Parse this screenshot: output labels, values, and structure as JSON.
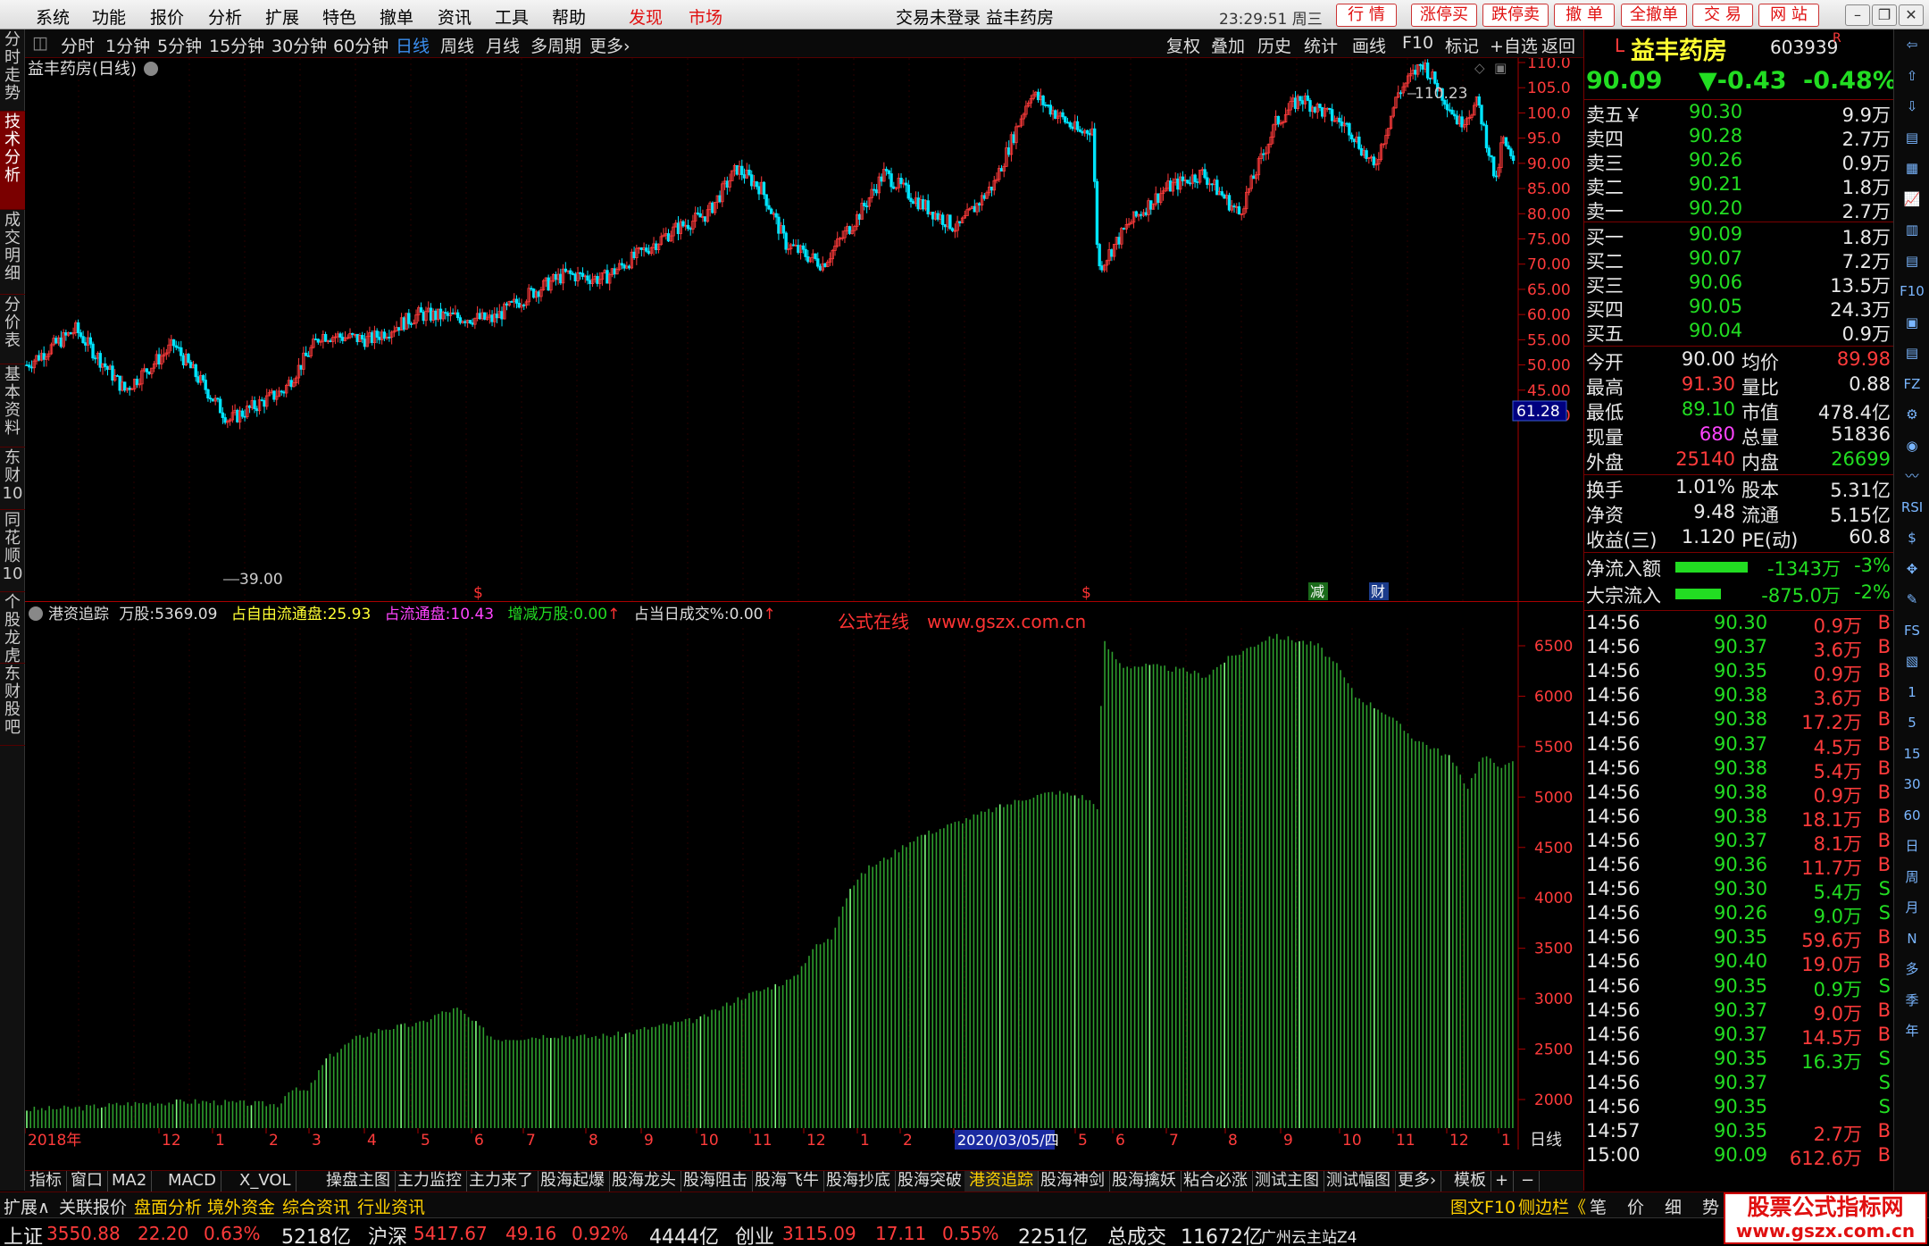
{
  "menubar": {
    "items": [
      "系统",
      "功能",
      "报价",
      "分析",
      "扩展",
      "特色",
      "撤单",
      "资讯",
      "工具",
      "帮助"
    ],
    "discover": "发现",
    "market": "市场",
    "title": "交易未登录 益丰药房",
    "time": "23:29:51 周三",
    "buttons": [
      "行 情",
      "涨停买",
      "跌停卖",
      "撤 单",
      "全撤单",
      "交 易",
      "网 站"
    ]
  },
  "lefttabs": [
    "分时走势",
    "技术分析",
    "成交明细",
    "分价表",
    "基本资料",
    "东财10",
    "同花顺10",
    "个股龙虎",
    "东财股吧"
  ],
  "periodbar": {
    "items": [
      "分时",
      "1分钟",
      "5分钟",
      "15分钟",
      "30分钟",
      "60分钟",
      "日线",
      "周线",
      "月线",
      "多周期",
      "更多›"
    ],
    "right": [
      "复权",
      "叠加",
      "历史",
      "统计",
      "画线",
      "F10",
      "标记",
      "+自选",
      "返回"
    ]
  },
  "main": {
    "title": "益丰药房(日线)",
    "high_label": "110.23",
    "low_label": "39.00",
    "price_box": "61.28",
    "y_ticks": [
      "110.0",
      "105.0",
      "100.0",
      "95.0",
      "90.00",
      "85.00",
      "80.00",
      "75.00",
      "70.00",
      "65.00",
      "60.00",
      "55.00",
      "50.00",
      "45.00",
      "40.00"
    ],
    "markers": [
      "$",
      "$",
      "减",
      "财"
    ]
  },
  "sub": {
    "name": "港资追踪",
    "unit_label": "万股:",
    "unit_val": "5369.09",
    "l1": "占自由流通盘:",
    "v1": "25.93",
    "l2": "占流通盘:",
    "v2": "10.43",
    "l3": "增减万股:",
    "v3": "0.00",
    "l4": "占当日成交%:",
    "v4": "0.00",
    "credit": "公式在线　www.gszx.com.cn",
    "y_ticks": [
      "6500",
      "6000",
      "5500",
      "5000",
      "4500",
      "4000",
      "3500",
      "3000",
      "2500",
      "2000"
    ]
  },
  "xaxis": {
    "labels": [
      "2018年",
      "12",
      "1",
      "2",
      "3",
      "4",
      "5",
      "6",
      "7",
      "8",
      "9",
      "10",
      "11",
      "12",
      "1",
      "2",
      "3",
      "5",
      "6",
      "7",
      "8",
      "9",
      "10",
      "11",
      "12",
      "1"
    ],
    "cursor_date": "2020/03/05/四",
    "period": "日线"
  },
  "stock": {
    "flag": "L",
    "name": "益丰药房",
    "code": "603939",
    "r": "R",
    "price": "90.09",
    "change": "▼-0.43",
    "pct": "-0.48%"
  },
  "orderbook": {
    "asks": [
      {
        "label": "卖五￥",
        "price": "90.30",
        "vol": "9.9万"
      },
      {
        "label": "卖四",
        "price": "90.28",
        "vol": "2.7万"
      },
      {
        "label": "卖三",
        "price": "90.26",
        "vol": "0.9万"
      },
      {
        "label": "卖二",
        "price": "90.21",
        "vol": "1.8万"
      },
      {
        "label": "卖一",
        "price": "90.20",
        "vol": "2.7万"
      }
    ],
    "bids": [
      {
        "label": "买一",
        "price": "90.09",
        "vol": "1.8万"
      },
      {
        "label": "买二",
        "price": "90.07",
        "vol": "7.2万"
      },
      {
        "label": "买三",
        "price": "90.06",
        "vol": "13.5万"
      },
      {
        "label": "买四",
        "price": "90.05",
        "vol": "24.3万"
      },
      {
        "label": "买五",
        "price": "90.04",
        "vol": "0.9万"
      }
    ]
  },
  "stats": [
    {
      "l": "今开",
      "v": "90.00",
      "l2": "均价",
      "v2": "89.98"
    },
    {
      "l": "最高",
      "v": "91.30",
      "l2": "量比",
      "v2": "0.88"
    },
    {
      "l": "最低",
      "v": "89.10",
      "l2": "市值",
      "v2": "478.4亿"
    },
    {
      "l": "现量",
      "v": "680",
      "l2": "总量",
      "v2": "51836"
    },
    {
      "l": "外盘",
      "v": "25140",
      "l2": "内盘",
      "v2": "26699"
    },
    {
      "l": "换手",
      "v": "1.01%",
      "l2": "股本",
      "v2": "5.31亿"
    },
    {
      "l": "净资",
      "v": "9.48",
      "l2": "流通",
      "v2": "5.15亿"
    },
    {
      "l": "收益(三)",
      "v": "1.120",
      "l2": "PE(动)",
      "v2": "60.8"
    }
  ],
  "flows": [
    {
      "l": "净流入额",
      "v": "-1343万",
      "p": "-3%",
      "bar": 0.55
    },
    {
      "l": "大宗流入",
      "v": "-875.0万",
      "p": "-2%",
      "bar": 0.35
    }
  ],
  "ticks": [
    [
      "14:56",
      "90.30",
      "0.9万",
      "B"
    ],
    [
      "14:56",
      "90.37",
      "3.6万",
      "B"
    ],
    [
      "14:56",
      "90.35",
      "0.9万",
      "B"
    ],
    [
      "14:56",
      "90.38",
      "3.6万",
      "B"
    ],
    [
      "14:56",
      "90.38",
      "17.2万",
      "B"
    ],
    [
      "14:56",
      "90.37",
      "4.5万",
      "B"
    ],
    [
      "14:56",
      "90.38",
      "5.4万",
      "B"
    ],
    [
      "14:56",
      "90.38",
      "0.9万",
      "B"
    ],
    [
      "14:56",
      "90.38",
      "18.1万",
      "B"
    ],
    [
      "14:56",
      "90.37",
      "8.1万",
      "B"
    ],
    [
      "14:56",
      "90.36",
      "11.7万",
      "B"
    ],
    [
      "14:56",
      "90.30",
      "5.4万",
      "S"
    ],
    [
      "14:56",
      "90.26",
      "9.0万",
      "S"
    ],
    [
      "14:56",
      "90.35",
      "59.6万",
      "B"
    ],
    [
      "14:56",
      "90.40",
      "19.0万",
      "B"
    ],
    [
      "14:56",
      "90.35",
      "0.9万",
      "S"
    ],
    [
      "14:56",
      "90.37",
      "9.0万",
      "B"
    ],
    [
      "14:56",
      "90.37",
      "14.5万",
      "B"
    ],
    [
      "14:56",
      "90.35",
      "16.3万",
      "S"
    ],
    [
      "14:56",
      "90.37",
      "",
      "S"
    ],
    [
      "14:56",
      "90.35",
      "",
      "S"
    ],
    [
      "14:57",
      "90.35",
      "2.7万",
      "B"
    ],
    [
      "15:00",
      "90.09",
      "612.6万",
      "B"
    ]
  ],
  "iconcol": [
    "⇦",
    "⇧",
    "⇩",
    "▤",
    "▦",
    "📈",
    "▥",
    "▤",
    "F10",
    "▣",
    "▤",
    "FZ",
    "⚙",
    "◉",
    "〰",
    "RSI",
    "$",
    "✥",
    "✎",
    "FS",
    "▧",
    "1",
    "5",
    "15",
    "30",
    "60",
    "日",
    "周",
    "月",
    "N",
    "多",
    "季",
    "年"
  ],
  "tabs": [
    "指标",
    "窗口",
    "MA2",
    "MACD",
    "X_VOL",
    "操盘主图",
    "主力监控",
    "主力来了",
    "股海起爆",
    "股海龙头",
    "股海阻击",
    "股海飞牛",
    "股海抄底",
    "股海突破",
    "港资追踪",
    "股海神剑",
    "股海擒妖",
    "粘合必涨",
    "测试主图",
    "测试幅图",
    "更多›",
    "模板",
    "+",
    "−"
  ],
  "ext": {
    "items": [
      "扩展∧",
      "关联报价",
      "盘面分析",
      "境外资金",
      "综合资讯",
      "行业资讯"
    ],
    "right": [
      "图文F10",
      "侧边栏《",
      "笔",
      "价",
      "细",
      "势"
    ]
  },
  "status": {
    "sh": "上证",
    "sh_v": "3550.88",
    "sh_c": "22.20",
    "sh_p": "0.63%",
    "sh_a": "5218亿",
    "hs": "沪深",
    "hs_v": "5417.67",
    "hs_c": "49.16",
    "hs_p": "0.92%",
    "hs_a": "4444亿",
    "cy": "创业",
    "cy_v": "3115.09",
    "cy_c": "17.11",
    "cy_p": "0.55%",
    "cy_a": "2251亿",
    "total_l": "总成交",
    "total_v": "11672亿",
    "site": "广州云主站Z4"
  },
  "watermark": {
    "l1": "股票公式指标网",
    "l2": "www.gszx.com.cn"
  }
}
